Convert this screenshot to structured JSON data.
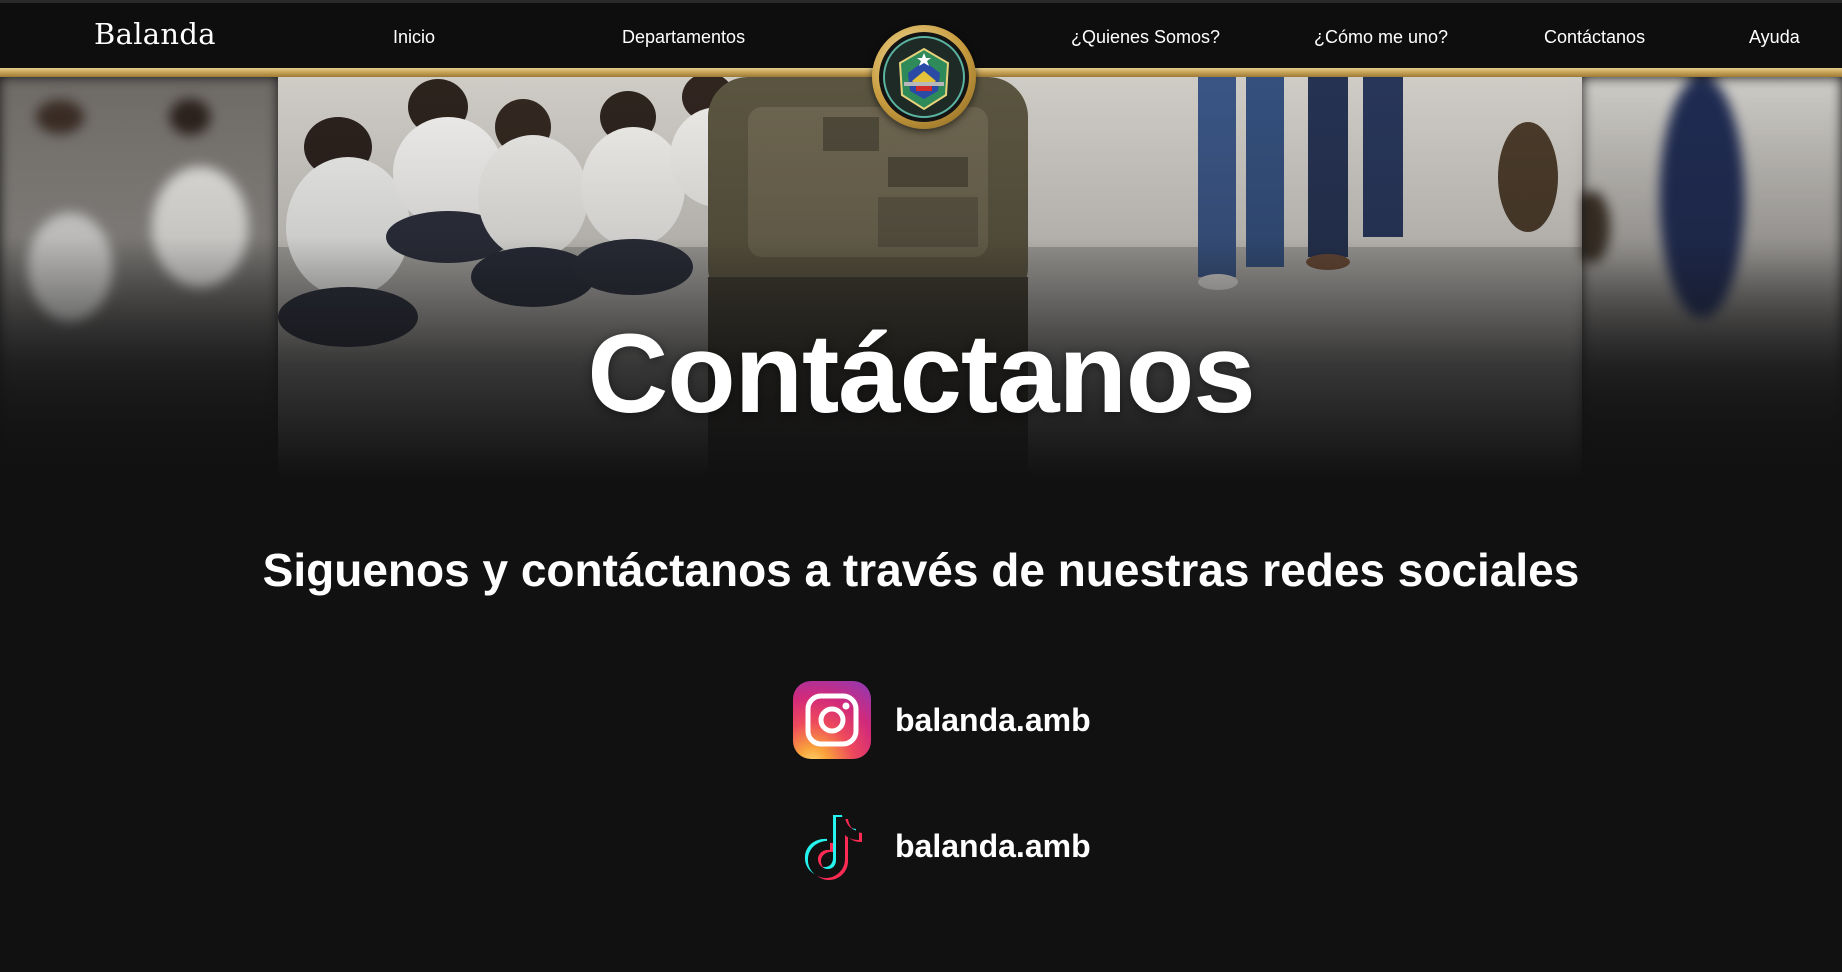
{
  "navbar": {
    "brand": "Balanda",
    "links": [
      "Inicio",
      "Departamentos",
      "¿Quienes Somos?",
      "¿Cómo me uno?",
      "Contáctanos",
      "Ayuda"
    ],
    "accent_color": "#c9a55a"
  },
  "hero": {
    "title": "Contáctanos"
  },
  "content": {
    "subtitle": "Siguenos y contáctanos a través de nuestras redes sociales",
    "socials": [
      {
        "icon": "instagram-icon",
        "handle": "balanda.amb"
      },
      {
        "icon": "tiktok-icon",
        "handle": "balanda.amb"
      }
    ]
  },
  "colors": {
    "background": "#111112",
    "navbar": "#0e0e0e",
    "gold": "#c9a55a",
    "text": "#ffffff"
  }
}
